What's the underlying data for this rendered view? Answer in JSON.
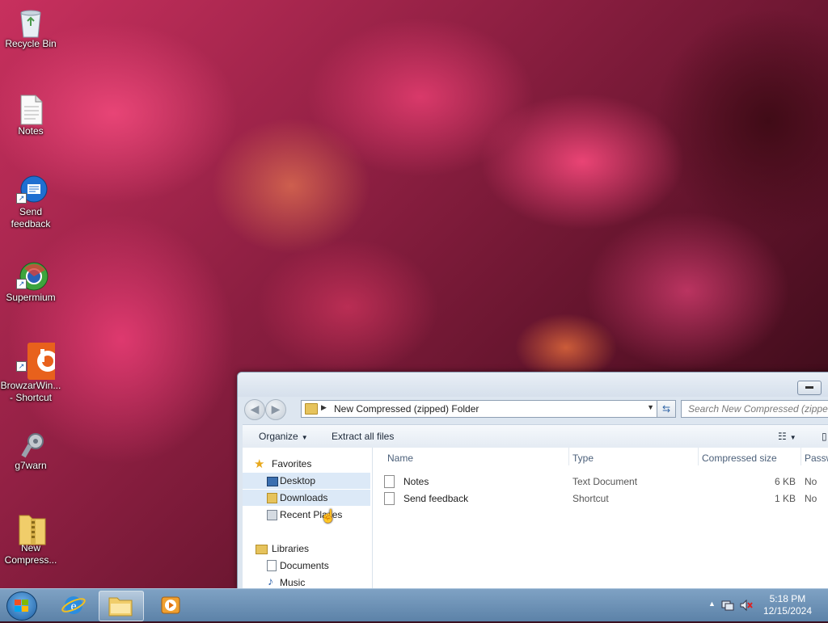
{
  "desktop": {
    "icons": [
      {
        "label": "Recycle Bin",
        "icon": "recycle-bin-icon",
        "shortcut": false
      },
      {
        "label": "Notes",
        "icon": "text-file-icon",
        "shortcut": false
      },
      {
        "label": "Send feedback",
        "icon": "feedback-icon",
        "shortcut": true
      },
      {
        "label": "Supermium",
        "icon": "supermium-browser-icon",
        "shortcut": true
      },
      {
        "label": "BrowzarWin... - Shortcut",
        "icon": "browzar-icon",
        "shortcut": true
      },
      {
        "label": "g7warn",
        "icon": "gear-app-icon",
        "shortcut": false
      },
      {
        "label": "New Compress...",
        "icon": "zip-folder-icon",
        "shortcut": false
      }
    ]
  },
  "explorer": {
    "address": "New Compressed (zipped) Folder",
    "search_placeholder": "Search New Compressed (zipped)",
    "toolbar": {
      "organize": "Organize",
      "extract": "Extract all files"
    },
    "nav": {
      "favorites": "Favorites",
      "desktop": "Desktop",
      "downloads": "Downloads",
      "recent": "Recent Places",
      "libraries": "Libraries",
      "documents": "Documents",
      "music": "Music"
    },
    "columns": {
      "name": "Name",
      "type": "Type",
      "size": "Compressed size",
      "password": "Passw"
    },
    "files": [
      {
        "name": "Notes",
        "type": "Text Document",
        "size": "6 KB",
        "password": "No"
      },
      {
        "name": "Send feedback",
        "type": "Shortcut",
        "size": "1 KB",
        "password": "No"
      }
    ]
  },
  "taskbar": {
    "time": "5:18 PM",
    "date": "12/15/2024"
  },
  "colors": {
    "selection": "#dce9f7",
    "taskbar": "#6a8fb5"
  }
}
